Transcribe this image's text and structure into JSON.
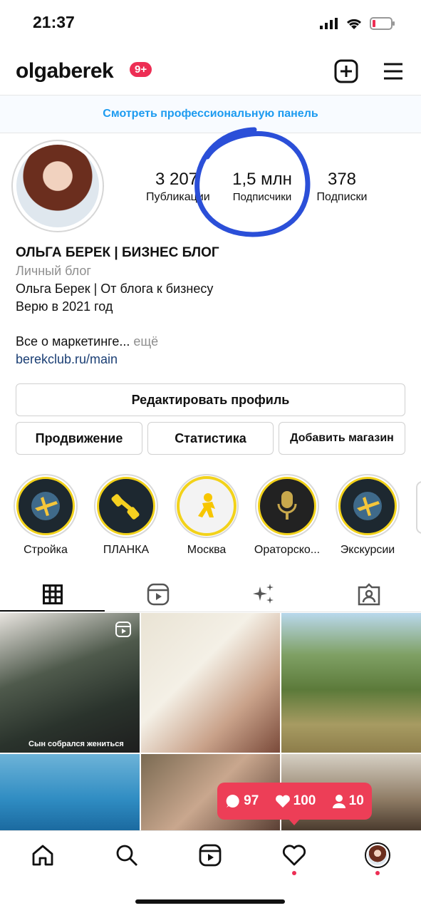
{
  "status_bar": {
    "time": "21:37"
  },
  "header": {
    "username": "olgaberek",
    "notifications_badge": "9+"
  },
  "pro_panel": {
    "label": "Смотреть профессиональную панель"
  },
  "stats": [
    {
      "value": "3 207",
      "label": "Публикации"
    },
    {
      "value": "1,5 млн",
      "label": "Подписчики"
    },
    {
      "value": "378",
      "label": "Подписки"
    }
  ],
  "bio": {
    "name": "ОЛЬГА БЕРЕК | БИЗНЕС БЛОГ",
    "category": "Личный блог",
    "line1": "Ольга Берек | От блога к бизнесу",
    "line2": "Верю в 2021 год",
    "line3": "Все о маркетинге...",
    "more": "ещё",
    "link": "berekclub.ru/main"
  },
  "buttons": {
    "edit_profile": "Редактировать профиль",
    "promotion": "Продвижение",
    "statistics": "Статистика",
    "add_shop": "Добавить магазин"
  },
  "highlights": [
    {
      "label": "Стройка",
      "icon": "plane-globe-icon"
    },
    {
      "label": "ПЛАНКА",
      "icon": "dumbbell-icon"
    },
    {
      "label": "Москва",
      "icon": "runner-icon"
    },
    {
      "label": "Ораторско...",
      "icon": "microphone-icon"
    },
    {
      "label": "Экскурсии",
      "icon": "plane-globe-icon"
    }
  ],
  "tabs": [
    "grid-icon",
    "reels-icon",
    "sparkles-icon",
    "tagged-icon"
  ],
  "grid": {
    "first_caption": "Сын собрался жениться"
  },
  "activity": {
    "comments": "97",
    "likes": "100",
    "followers": "10"
  },
  "colors": {
    "accent": "#1d9bf0",
    "badge": "#ed2e54",
    "link": "#1a3e74",
    "highlight_ink": "#2b4fd8"
  }
}
